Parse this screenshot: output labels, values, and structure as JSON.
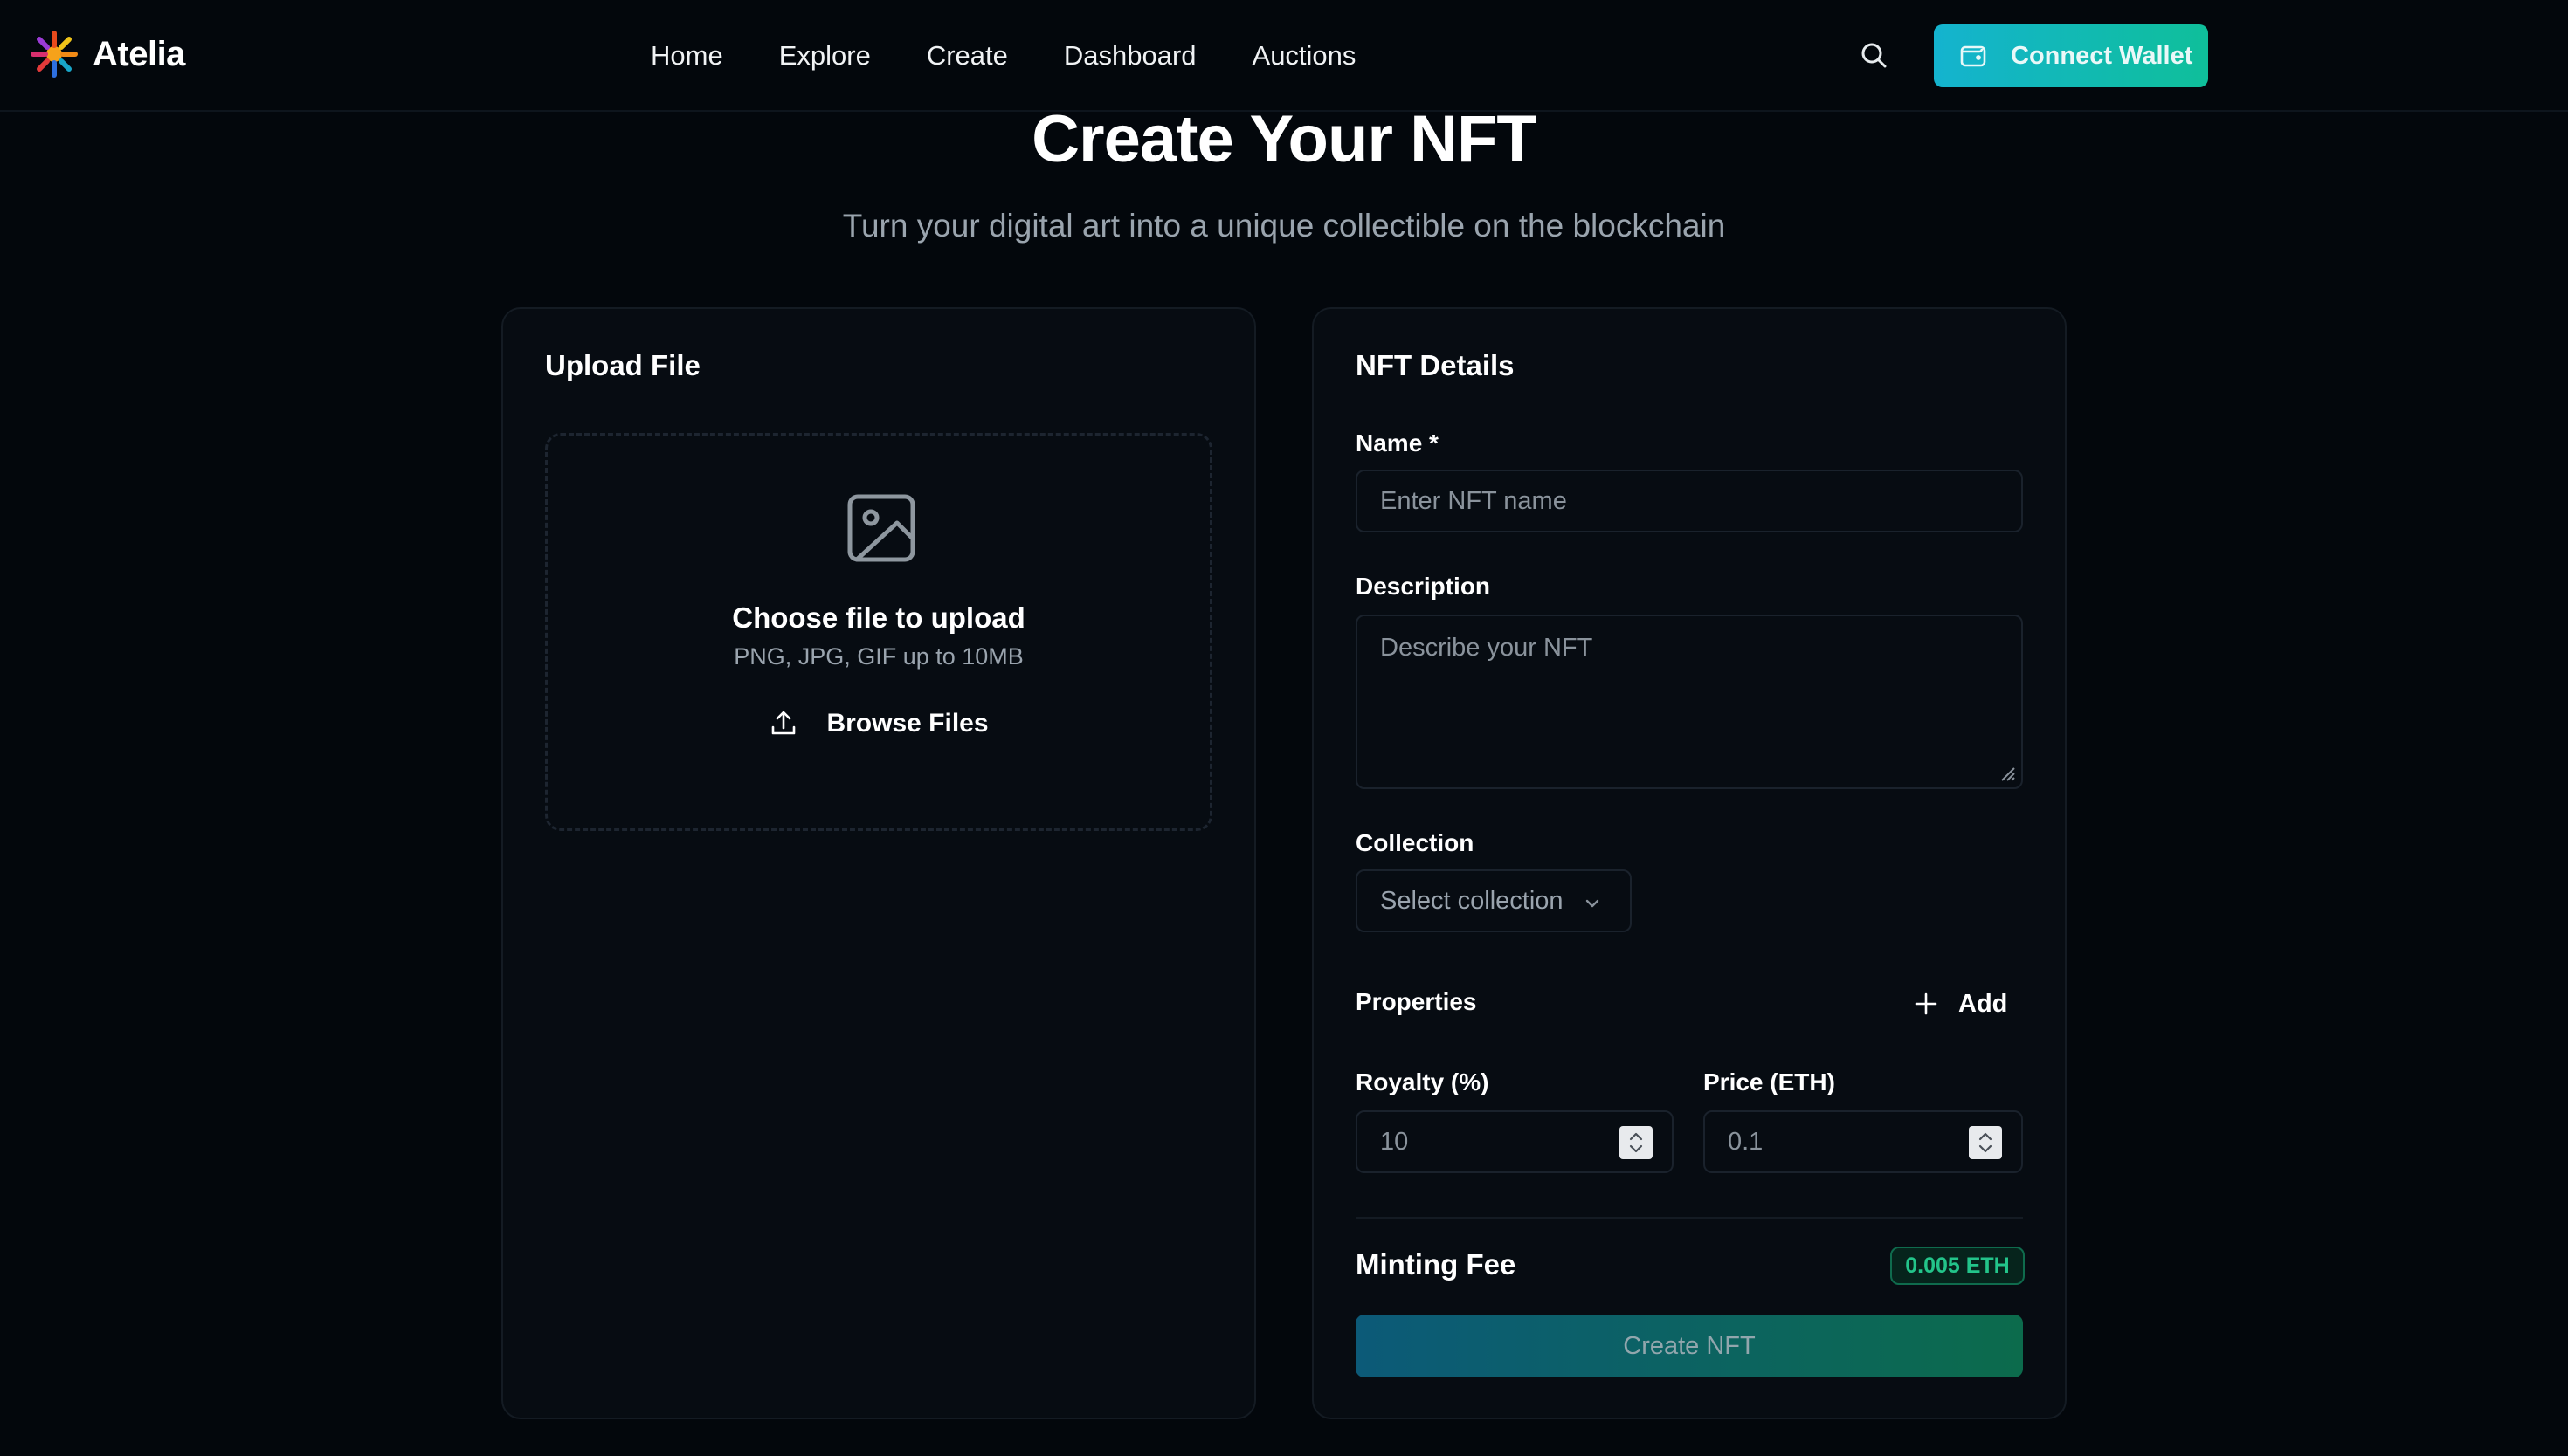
{
  "brand": {
    "name": "Atelia"
  },
  "nav": {
    "links": [
      "Home",
      "Explore",
      "Create",
      "Dashboard",
      "Auctions"
    ]
  },
  "header": {
    "wallet_label": "Connect Wallet"
  },
  "page": {
    "title": "Create Your NFT",
    "subtitle": "Turn your digital art into a unique collectible on the blockchain"
  },
  "upload": {
    "title": "Upload File",
    "prompt": "Choose file to upload",
    "hint": "PNG, JPG, GIF up to 10MB",
    "browse_label": "Browse Files"
  },
  "details": {
    "title": "NFT Details",
    "name_label": "Name *",
    "name_placeholder": "Enter NFT name",
    "description_label": "Description",
    "description_placeholder": "Describe your NFT",
    "collection_label": "Collection",
    "collection_placeholder": "Select collection",
    "properties_label": "Properties",
    "add_label": "Add",
    "royalty_label": "Royalty (%)",
    "royalty_value": "10",
    "price_label": "Price (ETH)",
    "price_value": "0.1",
    "fee_label": "Minting Fee",
    "fee_value": "0.005 ETH",
    "create_label": "Create NFT"
  },
  "colors": {
    "background": "#03070c",
    "accent_start": "#14b3cf",
    "accent_end": "#0fbf9a",
    "fee_green": "#23c48a"
  }
}
